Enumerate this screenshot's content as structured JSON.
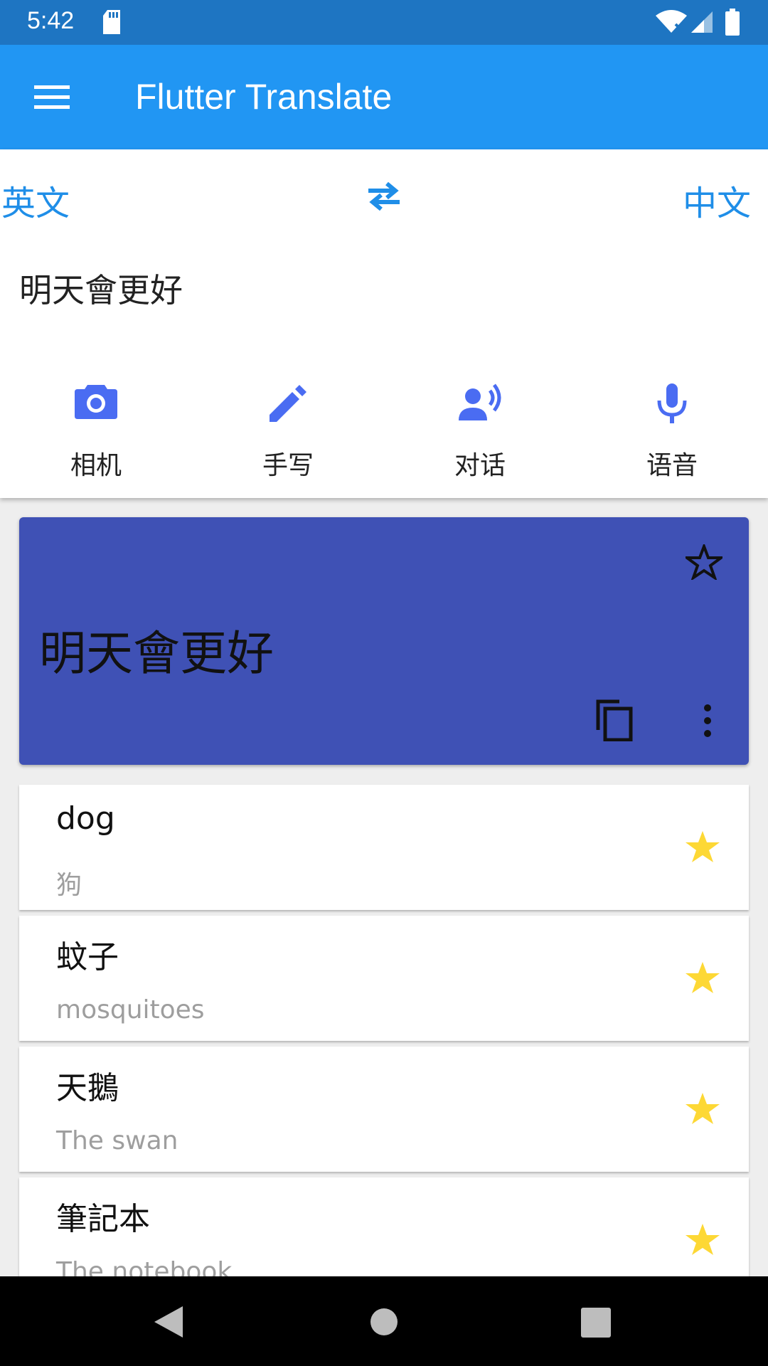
{
  "status_bar": {
    "time": "5:42"
  },
  "app_bar": {
    "title": "Flutter Translate"
  },
  "language_bar": {
    "source": "英文",
    "target": "中文"
  },
  "input": {
    "text": "明天會更好"
  },
  "tools": [
    {
      "label": "相机",
      "icon": "camera-icon"
    },
    {
      "label": "手写",
      "icon": "pencil-icon"
    },
    {
      "label": "对话",
      "icon": "conversation-icon"
    },
    {
      "label": "语音",
      "icon": "microphone-icon"
    }
  ],
  "result": {
    "text": "明天會更好"
  },
  "history": [
    {
      "source": "dog",
      "translation": "狗"
    },
    {
      "source": "蚊子",
      "translation": "mosquitoes"
    },
    {
      "source": "天鵝",
      "translation": "The swan"
    },
    {
      "source": "筆記本",
      "translation": "The notebook"
    }
  ],
  "colors": {
    "app_bar": "#2196f3",
    "status_bar": "#1e75c2",
    "accent": "#1f8ee8",
    "card": "#3f51b5",
    "icon": "#4a6cf2",
    "star": "#fdd835"
  }
}
